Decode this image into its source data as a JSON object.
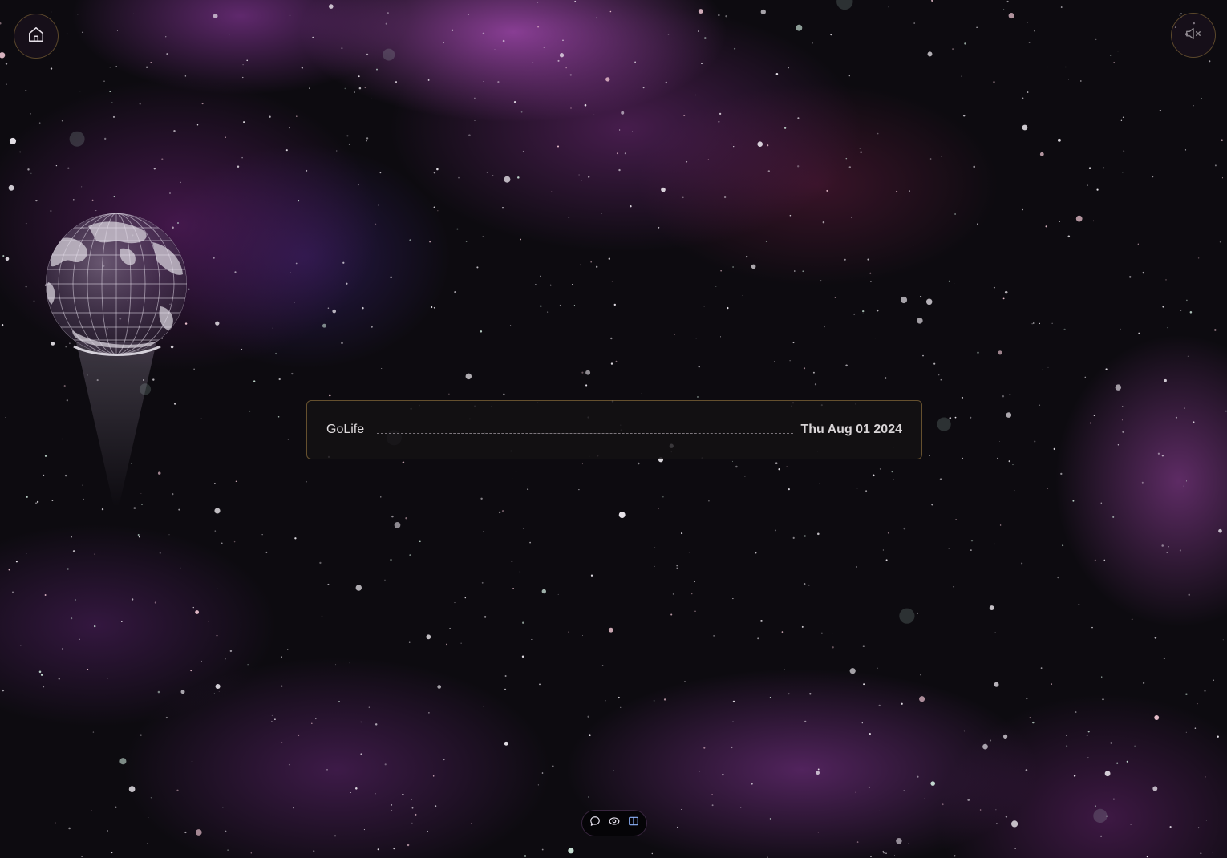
{
  "app": {
    "card_title": "GoLife",
    "card_date": "Thu Aug 01 2024"
  },
  "controls": {
    "home_icon": "home-icon",
    "mute_icon": "speaker-muted-icon"
  },
  "dock": {
    "items": [
      {
        "icon": "chat-bubble-icon"
      },
      {
        "icon": "eye-icon"
      },
      {
        "icon": "book-open-icon"
      }
    ]
  },
  "colors": {
    "accent_border": "#aa8746",
    "card_background": "#141114",
    "nebula_purple": "#b04ebe",
    "space_background": "#0d0b10",
    "dock_icon": "#e8e4f0",
    "dock_active_icon": "#8fb6ff"
  }
}
